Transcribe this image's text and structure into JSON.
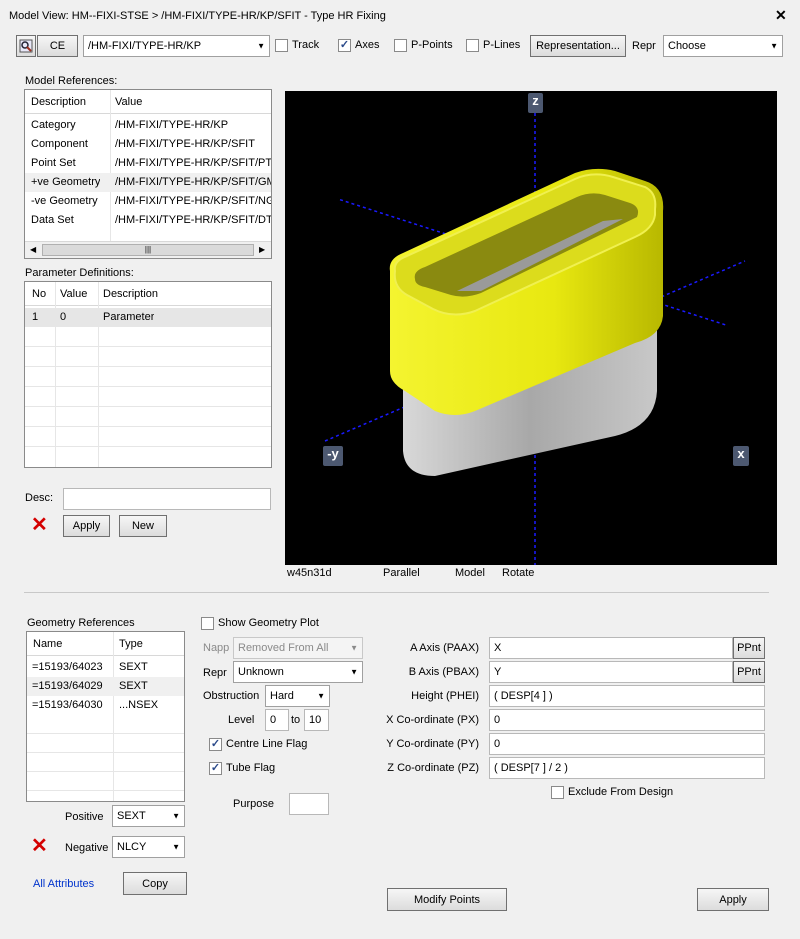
{
  "title": "Model View: HM--FIXI-STSE > /HM-FIXI/TYPE-HR/KP/SFIT - Type HR Fixing",
  "toolbar": {
    "ce_label": "CE",
    "element_path": "/HM-FIXI/TYPE-HR/KP",
    "track_label": "Track",
    "axes_label": "Axes",
    "ppoints_label": "P-Points",
    "plines_label": "P-Lines",
    "representation_label": "Representation...",
    "repr_label": "Repr",
    "repr_value": "Choose",
    "track_checked": false,
    "axes_checked": true,
    "ppoints_checked": false,
    "plines_checked": false
  },
  "model_refs": {
    "heading": "Model References:",
    "columns": [
      "Description",
      "Value"
    ],
    "rows": [
      {
        "desc": "Category",
        "value": "/HM-FIXI/TYPE-HR/KP"
      },
      {
        "desc": "Component",
        "value": "/HM-FIXI/TYPE-HR/KP/SFIT"
      },
      {
        "desc": "Point Set",
        "value": "/HM-FIXI/TYPE-HR/KP/SFIT/PT"
      },
      {
        "desc": "+ve Geometry",
        "value": "/HM-FIXI/TYPE-HR/KP/SFIT/GM"
      },
      {
        "desc": "-ve Geometry",
        "value": "/HM-FIXI/TYPE-HR/KP/SFIT/NG"
      },
      {
        "desc": "Data Set",
        "value": "/HM-FIXI/TYPE-HR/KP/SFIT/DT"
      }
    ]
  },
  "param_defs": {
    "heading": "Parameter Definitions:",
    "columns": [
      "No",
      "Value",
      "Description"
    ],
    "rows": [
      {
        "no": "1",
        "value": "0",
        "desc": "Parameter"
      }
    ]
  },
  "desc_label": "Desc:",
  "desc_value": "",
  "apply_label": "Apply",
  "new_label": "New",
  "viewport": {
    "status": [
      "w45n31d",
      "Parallel",
      "Model",
      "Rotate"
    ],
    "axis_z": "z",
    "axis_neg_y": "-y",
    "axis_x": "x"
  },
  "geom_refs": {
    "heading": "Geometry References",
    "columns": [
      "Name",
      "Type"
    ],
    "rows": [
      {
        "name": "=15193/64023",
        "type": "SEXT"
      },
      {
        "name": "=15193/64029",
        "type": "SEXT"
      },
      {
        "name": "=15193/64030",
        "type": "...NSEX"
      }
    ]
  },
  "positive_label": "Positive",
  "positive_value": "SEXT",
  "negative_label": "Negative",
  "negative_value": "NLCY",
  "all_attributes_label": "All Attributes",
  "copy_label": "Copy",
  "show_geom_plot_label": "Show Geometry Plot",
  "napp_label": "Napp",
  "napp_value": "Removed From All",
  "repr2_label": "Repr",
  "repr2_value": "Unknown",
  "obstruction_label": "Obstruction",
  "obstruction_value": "Hard",
  "level_label": "Level",
  "level_from": "0",
  "level_to_label": "to",
  "level_to": "10",
  "centre_line_label": "Centre Line Flag",
  "tube_flag_label": "Tube Flag",
  "purpose_label": "Purpose",
  "purpose_value": "",
  "attrs": [
    {
      "label": "A Axis (PAAX)",
      "value": "X",
      "btn": "PPnt"
    },
    {
      "label": "B Axis (PBAX)",
      "value": "Y",
      "btn": "PPnt"
    },
    {
      "label": "Height (PHEI)",
      "value": "( DESP[4 ] )"
    },
    {
      "label": "X Co-ordinate (PX)",
      "value": "0"
    },
    {
      "label": "Y Co-ordinate (PY)",
      "value": "0"
    },
    {
      "label": "Z Co-ordinate (PZ)",
      "value": "( DESP[7 ] / 2 )"
    }
  ],
  "exclude_label": "Exclude From Design",
  "modify_points_label": "Modify Points",
  "apply2_label": "Apply",
  "colors": {
    "box_top": "#f2f21a",
    "box_bottom": "#bdbdbd",
    "axis_line": "#1a1aff",
    "link": "#0033cc",
    "error_x": "#d40000"
  }
}
